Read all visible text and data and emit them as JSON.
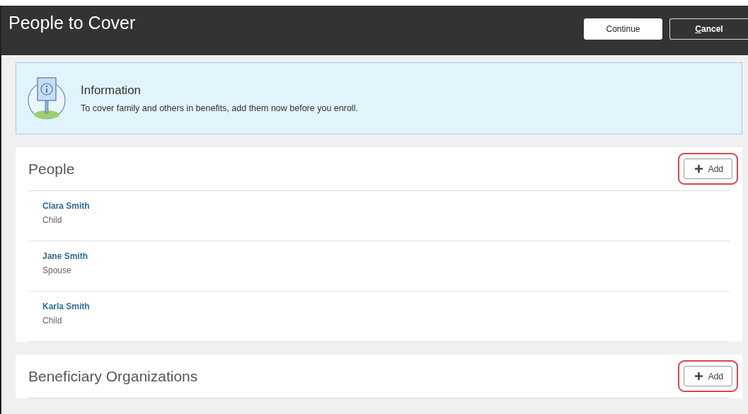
{
  "header": {
    "title": "People to Cover",
    "buttons": [
      {
        "label": "Continue",
        "kind": "primary"
      },
      {
        "label": "Cancel",
        "kind": "secondary"
      }
    ]
  },
  "info": {
    "title": "Information",
    "message": "To cover family and others in benefits, add them now before you enroll."
  },
  "sections": [
    {
      "title": "People",
      "add_button": {
        "label": "Add",
        "highlighted": true
      },
      "items": [
        {
          "name": "Clara Smith",
          "relation": "Child"
        },
        {
          "name": "Jane Smith",
          "relation": "Spouse"
        },
        {
          "name": "Karla Smith",
          "relation": "Child"
        }
      ]
    },
    {
      "title": "Beneficiary Organizations",
      "add_button": {
        "label": "Add",
        "highlighted": true
      }
    }
  ]
}
